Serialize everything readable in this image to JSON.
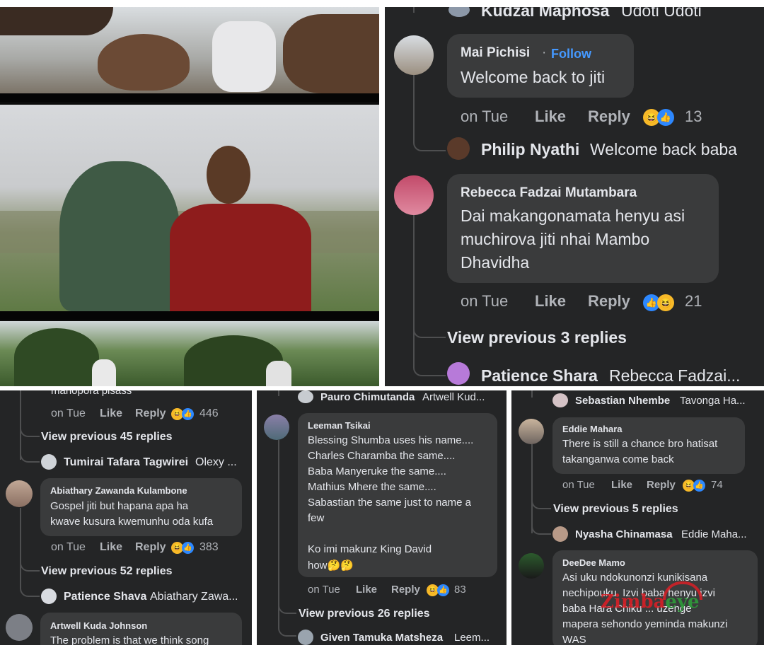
{
  "photo": {
    "alt": "music video stills"
  },
  "panel_top_right": {
    "top_reply": {
      "name": "Kudzai Maphosa",
      "text": "Udoti Udoti"
    },
    "comment1": {
      "name": "Mai Pichisi",
      "follow": "Follow",
      "text": "Welcome back to jiti",
      "time": "on Tue",
      "like": "Like",
      "reply": "Reply",
      "count": "13"
    },
    "reply1": {
      "name": "Philip Nyathi",
      "text": "Welcome back baba"
    },
    "comment2": {
      "name": "Rebecca Fadzai Mutambara",
      "line1": "Dai makangonamata henyu asi",
      "line2": "muchirova jiti nhai Mambo",
      "line3": "Dhavidha",
      "time": "on Tue",
      "like": "Like",
      "reply": "Reply",
      "count": "21"
    },
    "view_prev": "View previous 3 replies",
    "reply2": {
      "name": "Patience Shara",
      "text": "Rebecca Fadzai..."
    }
  },
  "panel_bl": {
    "top_cut": "manopora pisass",
    "meta1": {
      "time": "on Tue",
      "like": "Like",
      "reply": "Reply",
      "count": "446"
    },
    "view_prev1": "View previous 45 replies",
    "reply1": {
      "name": "Tumirai Tafara Tagwirei",
      "text": "Olexy ..."
    },
    "comment": {
      "name": "Abiathary Zawanda Kulambone",
      "line1": "Gospel jiti but hapana apa ha",
      "line2": "kwave kusura kwemunhu oda kufa"
    },
    "meta2": {
      "time": "on Tue",
      "like": "Like",
      "reply": "Reply",
      "count": "383"
    },
    "view_prev2": "View previous 52 replies",
    "reply2": {
      "name": "Patience Shava",
      "text": "Abiathary Zawa..."
    },
    "comment_cut": {
      "name": "Artwell Kuda Johnson",
      "line1": "The problem is that we think song"
    }
  },
  "panel_bm": {
    "reply_top": {
      "name": "Pauro Chimutanda",
      "text": "Artwell Kud..."
    },
    "comment": {
      "name": "Leeman Tsikai",
      "lines": [
        "Blessing Shumba uses his name....",
        "Charles Charamba the same....",
        "Baba Manyeruke the same....",
        "Mathius Mhere the same....",
        "Sabastian the same just to name a",
        "few",
        "",
        "Ko imi makunz King David",
        "how🤔🤔"
      ]
    },
    "meta": {
      "time": "on Tue",
      "like": "Like",
      "reply": "Reply",
      "count": "83"
    },
    "view_prev": "View previous 26 replies",
    "reply_bottom": {
      "name": "Given Tamuka Matsheza",
      "text": "Leem..."
    }
  },
  "panel_br": {
    "reply_top": {
      "name": "Sebastian Nhembe",
      "text": "Tavonga Ha..."
    },
    "comment1": {
      "name": "Eddie Mahara",
      "line1": "There is still a chance bro hatisat",
      "line2": "takanganwa come back"
    },
    "meta": {
      "time": "on Tue",
      "like": "Like",
      "reply": "Reply",
      "count": "74"
    },
    "view_prev": "View previous 5 replies",
    "reply1": {
      "name": "Nyasha Chinamasa",
      "text": "Eddie Maha..."
    },
    "comment2": {
      "name": "DeeDee Mamo",
      "lines": [
        "Asi uku ndokunonzi kunikisana",
        "nechipouku. Izvi baba henyu izvi",
        "baba Hara Chiku ... uzenge",
        "mapera sehondo yeminda makunzi",
        "WAS"
      ]
    }
  },
  "watermark": {
    "text": "Zimba",
    "text2": "eye"
  },
  "colors": {
    "bg": "#242526",
    "bubble": "#3a3b3c",
    "link": "#4599ff"
  },
  "icons": [
    "haha-icon",
    "like-icon"
  ]
}
